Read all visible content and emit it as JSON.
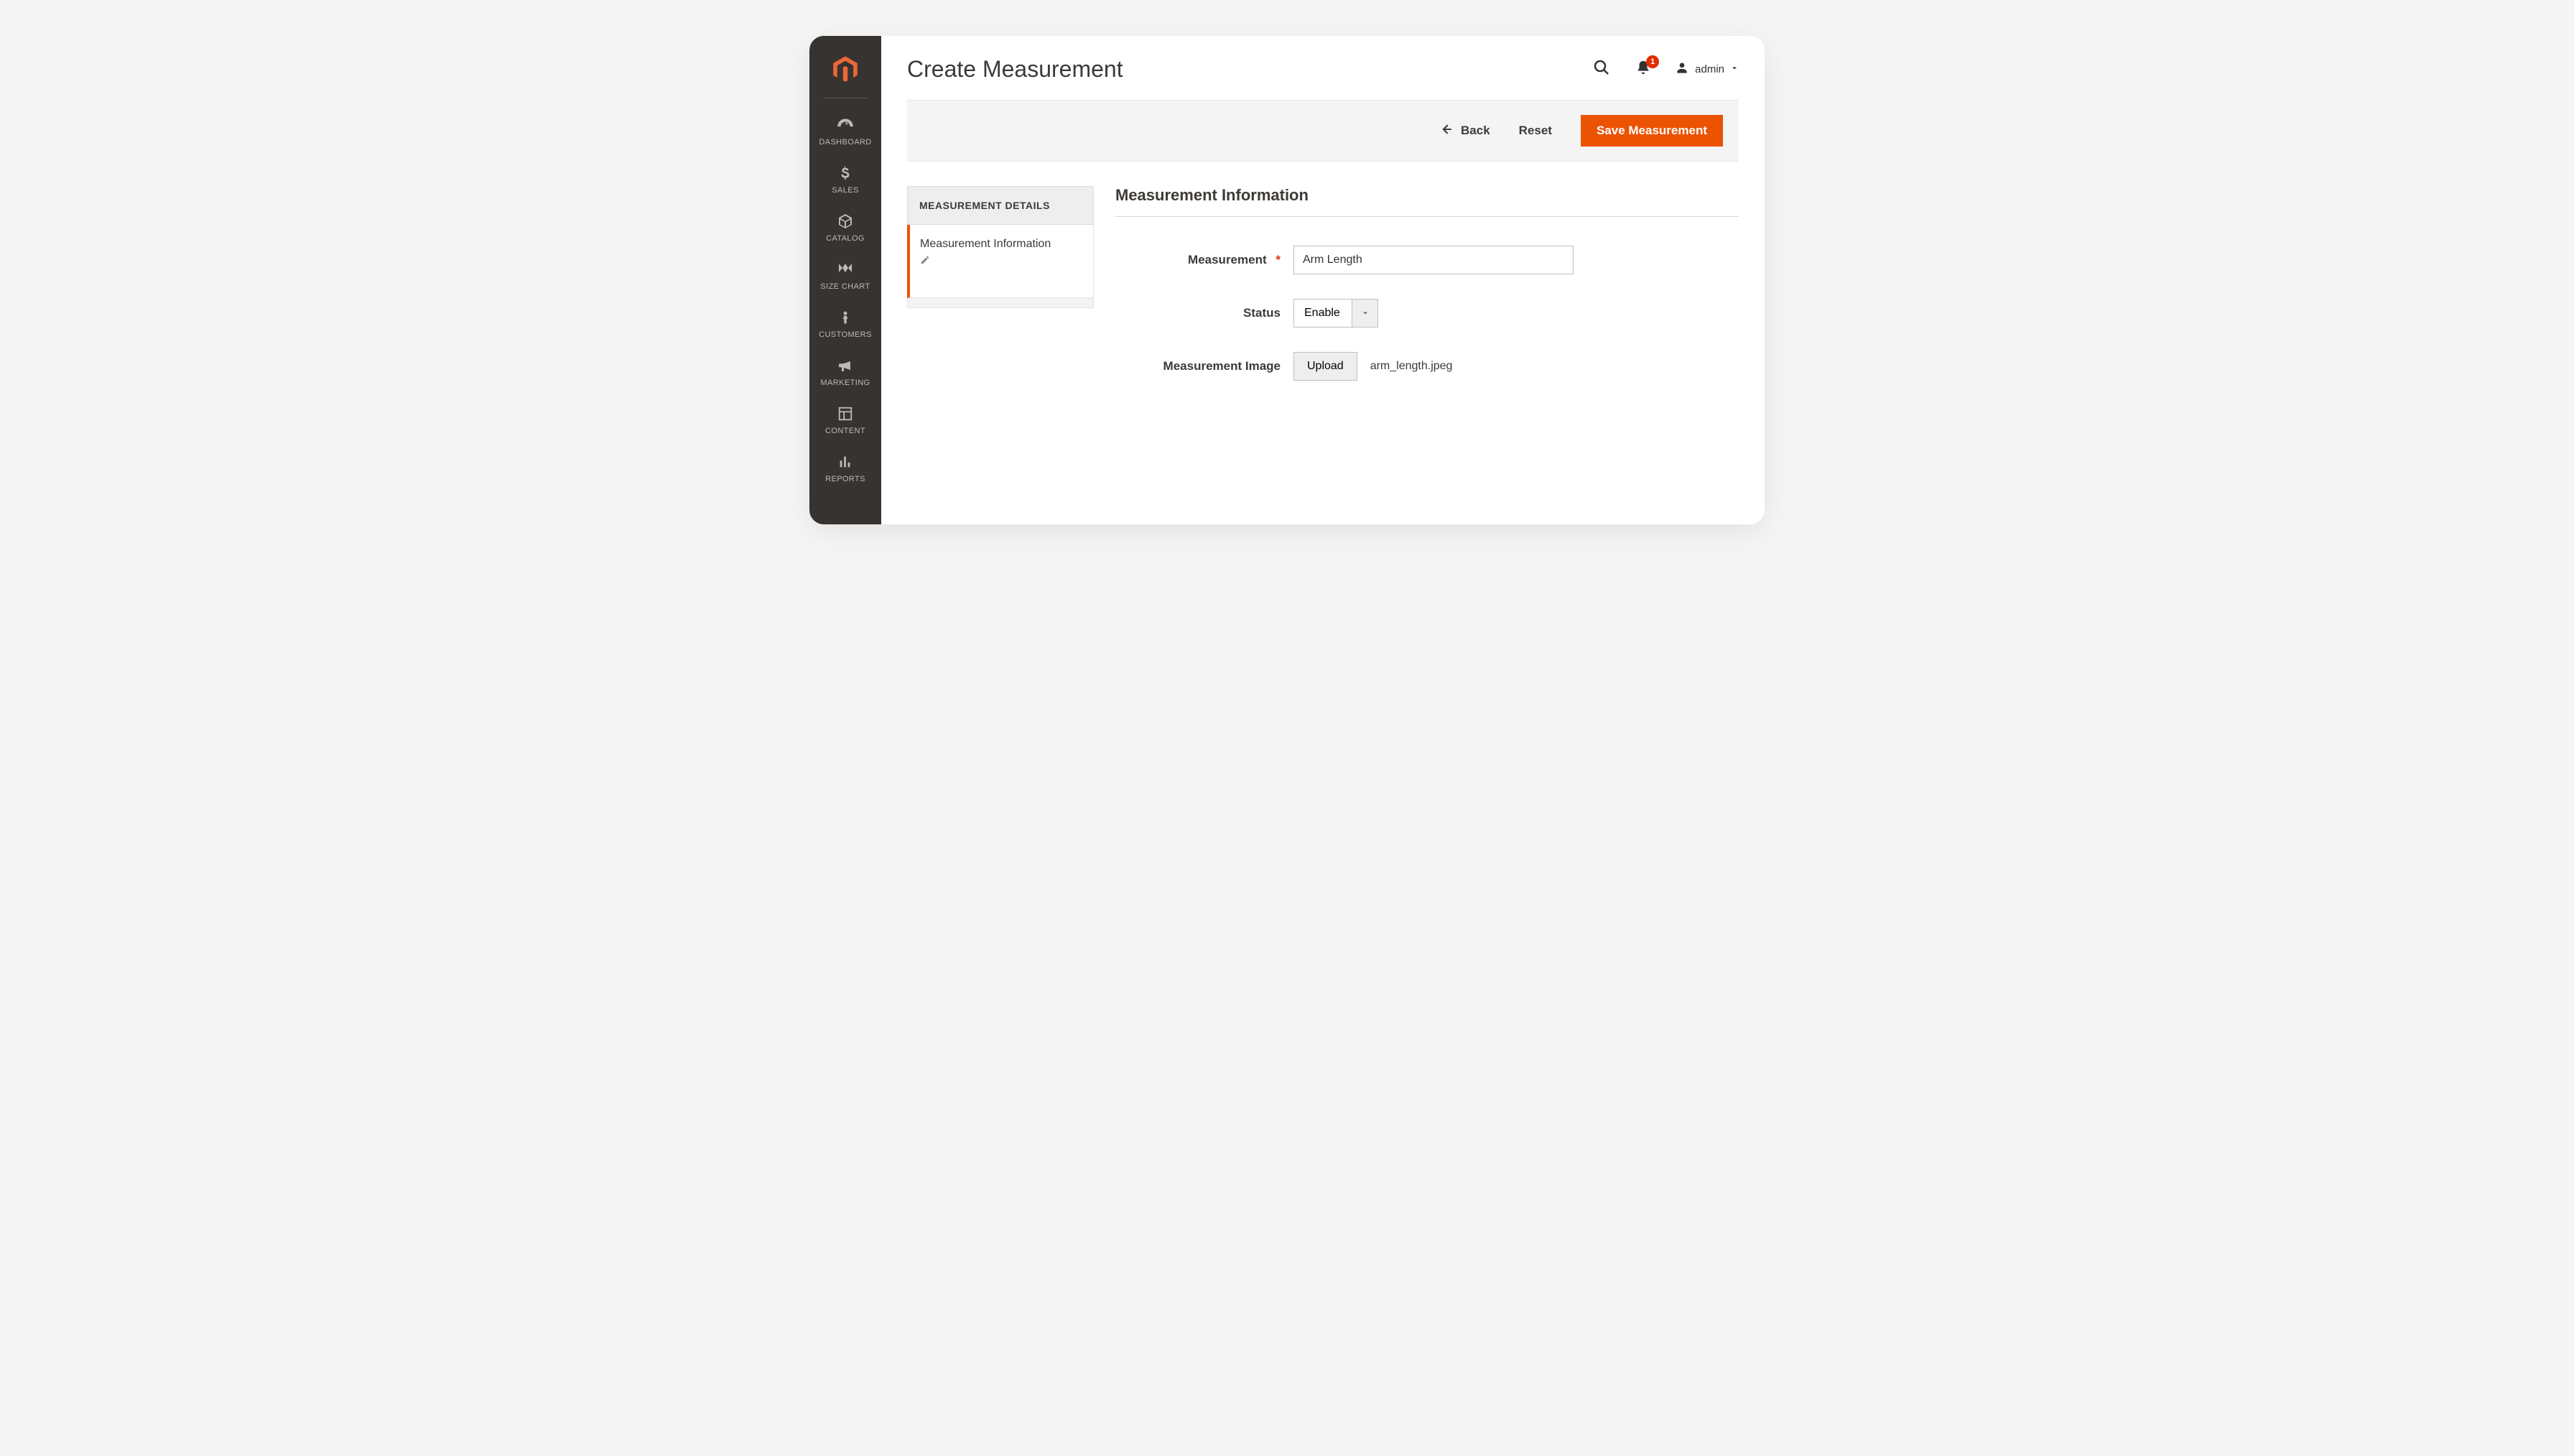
{
  "sidebar": {
    "items": [
      {
        "label": "DASHBOARD"
      },
      {
        "label": "SALES"
      },
      {
        "label": "CATALOG"
      },
      {
        "label": "SIZE CHART"
      },
      {
        "label": "CUSTOMERS"
      },
      {
        "label": "MARKETING"
      },
      {
        "label": "CONTENT"
      },
      {
        "label": "REPORTS"
      }
    ]
  },
  "header": {
    "title": "Create Measurement",
    "notification_count": "1",
    "user_label": "admin"
  },
  "actions": {
    "back": "Back",
    "reset": "Reset",
    "save": "Save Measurement"
  },
  "tabs": {
    "group_title": "MEASUREMENT DETAILS",
    "item_label": "Measurement Information"
  },
  "section": {
    "title": "Measurement Information"
  },
  "form": {
    "measurement_label": "Measurement",
    "measurement_value": "Arm Length",
    "status_label": "Status",
    "status_value": "Enable",
    "image_label": "Measurement Image",
    "upload_label": "Upload",
    "filename": "arm_length.jpeg"
  }
}
